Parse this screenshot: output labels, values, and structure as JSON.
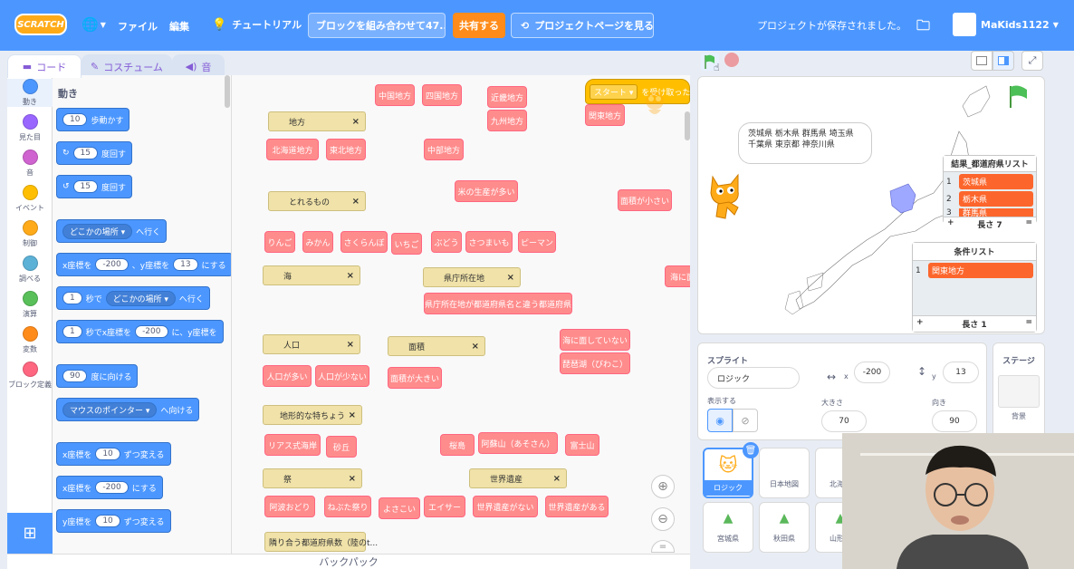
{
  "menubar": {
    "logo": "SCRATCH",
    "file": "ファイル",
    "edit": "編集",
    "tutorial": "チュートリアル",
    "project_title": "ブロックを組み合わせて47...",
    "share": "共有する",
    "project_page": "プロジェクトページを見る",
    "saved_status": "プロジェクトが保存されました。",
    "username": "MaKids1122"
  },
  "tabs": {
    "code": "コード",
    "costume": "コスチューム",
    "sound": "音"
  },
  "categories": [
    {
      "label": "動き",
      "color": "#4c97ff"
    },
    {
      "label": "見た目",
      "color": "#9966ff"
    },
    {
      "label": "音",
      "color": "#cf63cf"
    },
    {
      "label": "イベント",
      "color": "#ffbf00"
    },
    {
      "label": "制御",
      "color": "#ffab19"
    },
    {
      "label": "調べる",
      "color": "#5cb1d6"
    },
    {
      "label": "演算",
      "color": "#59c059"
    },
    {
      "label": "変数",
      "color": "#ff8c1a"
    },
    {
      "label": "ブロック定義",
      "color": "#ff6680"
    }
  ],
  "palette": {
    "heading": "動き",
    "move_val": "10",
    "move_txt": "歩動かす",
    "turn_r_val": "15",
    "turn_r_txt": "度回す",
    "turn_l_val": "15",
    "turn_l_txt": "度回す",
    "goto_dd": "どこかの場所",
    "goto_txt": "へ行く",
    "gotoxy_a": "x座標を",
    "gotoxy_x": "-200",
    "gotoxy_b": "、y座標を",
    "gotoxy_y": "13",
    "gotoxy_c": "にする",
    "glide_val": "1",
    "glide_a": "秒で",
    "glide_dd": "どこかの場所",
    "glide_b": "へ行く",
    "glidexy_val": "1",
    "glidexy_a": "秒でx座標を",
    "glidexy_x": "-200",
    "glidexy_b": "に、y座標を",
    "point_val": "90",
    "point_txt": "度に向ける",
    "towards_dd": "マウスのポインター",
    "towards_txt": "へ向ける",
    "chx_a": "x座標を",
    "chx_val": "10",
    "chx_b": "ずつ変える",
    "setx_a": "x座標を",
    "setx_val": "-200",
    "setx_b": "にする",
    "chy_a": "y座標を",
    "chy_val": "10",
    "chy_b": "ずつ変える"
  },
  "workspace": {
    "red_blocks": [
      "中国地方",
      "四国地方",
      "近畿地方",
      "九州地方",
      "関東地方",
      "北海道地方",
      "東北地方",
      "中部地方",
      "米の生産が多い",
      "面積が小さい",
      "りんご",
      "みかん",
      "さくらんぼ",
      "いちご",
      "ぶどう",
      "さつまいも",
      "ピーマン",
      "海に面",
      "県庁所在地が都道府県名と違う都道府県",
      "海に面していない",
      "琵琶湖（びわこ）",
      "人口が多い",
      "人口が少ない",
      "面積が大きい",
      "リアス式海岸",
      "砂丘",
      "桜島",
      "阿蘇山（あそさん）",
      "富士山",
      "阿波おどり",
      "ねぶた祭り",
      "よさこい",
      "エイサー",
      "世界遺産がない",
      "世界遺産がある"
    ],
    "olive_blocks": [
      "地方",
      "とれるもの",
      "海",
      "県庁所在地",
      "人口",
      "面積",
      "地形的な特ちょう",
      "祭",
      "世界遺産"
    ],
    "bottom_block": "隣り合う都道府県数（陸のt...",
    "event_block": "スタート",
    "event_suffix": "を受け取った"
  },
  "backpack": "バックパック",
  "stage": {
    "speech": "茨城県 栃木県 群馬県 埼玉県 千葉県 東京都 神奈川県",
    "result_list": {
      "title": "結果_都道府県リスト",
      "items": [
        {
          "n": "1",
          "v": "茨城県"
        },
        {
          "n": "2",
          "v": "栃木県"
        },
        {
          "n": "3",
          "v": "群馬県"
        }
      ],
      "length": "長さ 7"
    },
    "cond_list": {
      "title": "条件リスト",
      "items": [
        {
          "n": "1",
          "v": "関東地方"
        }
      ],
      "length": "長さ 1"
    }
  },
  "sprite_info": {
    "sprite_label": "スプライト",
    "name": "ロジック",
    "x_label": "x",
    "x": "-200",
    "y_label": "y",
    "y": "13",
    "show_label": "表示する",
    "size_label": "大きさ",
    "size": "70",
    "dir_label": "向き",
    "direction": "90"
  },
  "stage_pane": {
    "title": "ステージ",
    "bg_label": "背景"
  },
  "sprites": [
    "ロジック",
    "日本地図",
    "北海道",
    "宮城県",
    "秋田県",
    "山形県"
  ]
}
